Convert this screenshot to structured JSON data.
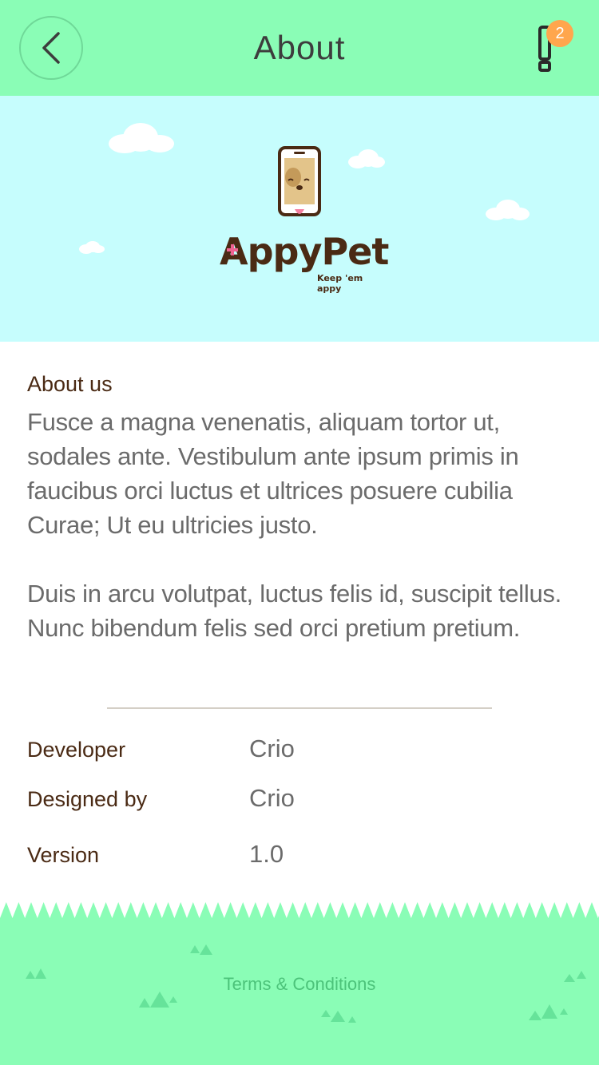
{
  "header": {
    "title": "About",
    "notification_count": "2"
  },
  "hero": {
    "brand_name": "AppyPet",
    "tagline": "Keep 'em appy"
  },
  "about": {
    "heading": "About us",
    "paragraphs": [
      "Fusce a magna venenatis, aliquam tortor ut, sodales ante. Vestibulum ante ipsum primis in faucibus orci luctus et ultrices posuere cubilia Curae; Ut eu ultricies justo.",
      "Duis in arcu volutpat, luctus felis id, suscipit tellus. Nunc bibendum felis sed orci pretium pretium."
    ]
  },
  "info": [
    {
      "label": "Developer",
      "value": "Crio"
    },
    {
      "label": "Designed by",
      "value": "Crio"
    },
    {
      "label": "Version",
      "value": "1.0"
    }
  ],
  "footer": {
    "terms_label": "Terms & Conditions"
  },
  "colors": {
    "header_bg": "#8afdb6",
    "hero_bg": "#c6fdfd",
    "badge": "#ffa64d",
    "brand_brown": "#4a2a14",
    "grass": "#8afdb6",
    "grass_dark": "#66e39a"
  },
  "icons": {
    "back": "chevron-left-icon",
    "notification": "exclamation-icon",
    "logo": "phone-pet-icon"
  }
}
